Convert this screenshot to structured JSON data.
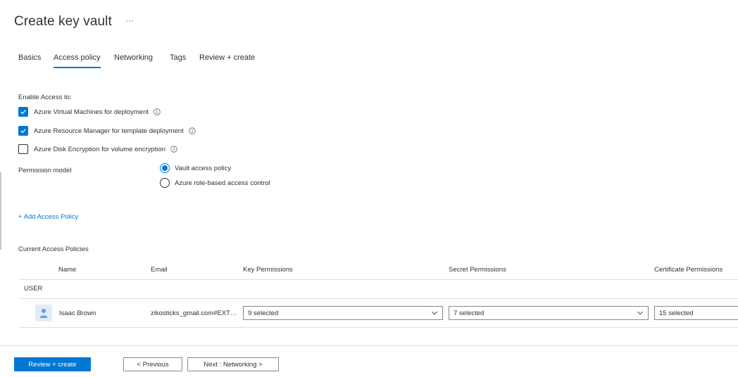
{
  "page": {
    "title": "Create key vault",
    "more": "···"
  },
  "tabs": [
    {
      "label": "Basics",
      "active": false
    },
    {
      "label": "Access policy",
      "active": true
    },
    {
      "label": "Networking",
      "active": false
    },
    {
      "label": "Tags",
      "active": false
    },
    {
      "label": "Review + create",
      "active": false
    }
  ],
  "access": {
    "enable_label": "Enable Access to:",
    "options": [
      {
        "label": "Azure Virtual Machines for deployment",
        "checked": true
      },
      {
        "label": "Azure Resource Manager for template deployment",
        "checked": true
      },
      {
        "label": "Azure Disk Encryption for volume encryption",
        "checked": false
      }
    ]
  },
  "permission_model": {
    "label": "Permission model",
    "options": [
      {
        "label": "Vault access policy",
        "selected": true
      },
      {
        "label": "Azure role-based access control",
        "selected": false
      }
    ]
  },
  "add_policy_label": "+ Add Access Policy",
  "policies": {
    "label": "Current Access Policies",
    "columns": [
      "Name",
      "Email",
      "Key Permissions",
      "Secret Permissions",
      "Certificate Permissions"
    ],
    "group": "USER",
    "rows": [
      {
        "name": "Isaac Brown",
        "email": "zikosticks_gmail.com#EXT#@zikostickshotmail.onmicrosoft.com",
        "key_permissions": "9 selected",
        "secret_permissions": "7 selected",
        "certificate_permissions": "15 selected"
      }
    ]
  },
  "footer": {
    "review_create": "Review + create",
    "previous": "< Previous",
    "next": "Next : Networking >"
  },
  "colors": {
    "accent": "#0078d4",
    "text": "#323130",
    "border": "#8a8886",
    "divider": "#e1dfdd"
  }
}
